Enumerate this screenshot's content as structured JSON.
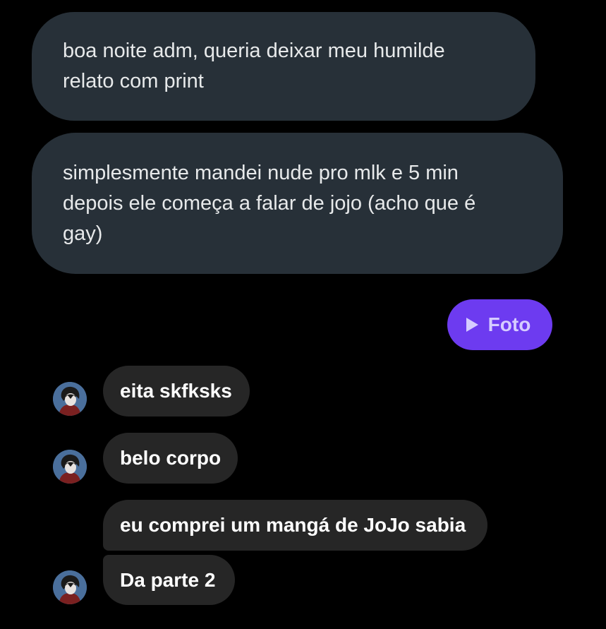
{
  "post": {
    "paragraph_1": [
      "boa noite adm, queria deixar meu humilde",
      "relato com print"
    ],
    "paragraph_2": [
      "simplesmente mandei nude pro mlk e 5 min",
      "depois ele começa a falar de jojo (acho que é",
      "gay)"
    ]
  },
  "attachment": {
    "label": "Foto",
    "icon": "play-icon",
    "color": "#6d3bf0"
  },
  "messages": [
    {
      "text": "eita skfksks"
    },
    {
      "text": "belo corpo"
    },
    {
      "text": "eu comprei um mangá de JoJo sabia"
    },
    {
      "text": "Da parte 2"
    }
  ],
  "colors": {
    "background": "#000000",
    "post_bubble": "#273038",
    "message_bubble": "#262626",
    "avatar": "#4a6f9c"
  }
}
